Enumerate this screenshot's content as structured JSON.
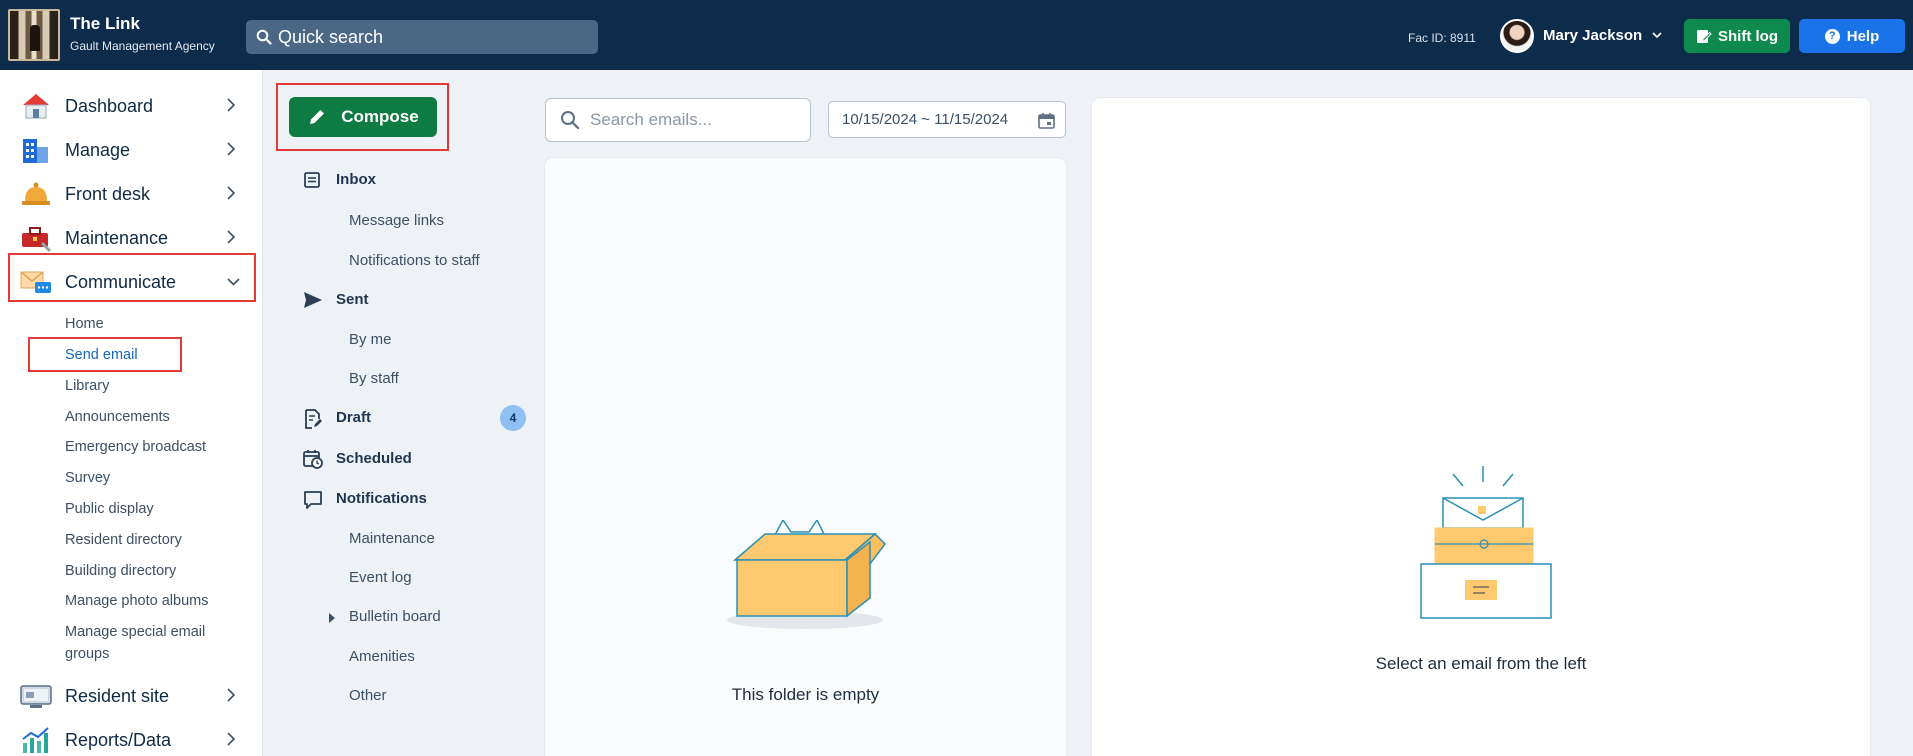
{
  "header": {
    "app_title": "The Link",
    "agency": "Gault Management Agency",
    "quick_search_placeholder": "Quick search",
    "fac_id": "Fac ID: 8911",
    "user_name": "Mary Jackson",
    "shift_log_label": "Shift log",
    "help_label": "Help"
  },
  "sidebar": {
    "items": [
      {
        "label": "Dashboard",
        "icon": "house-icon"
      },
      {
        "label": "Manage",
        "icon": "building-icon"
      },
      {
        "label": "Front desk",
        "icon": "bell-icon"
      },
      {
        "label": "Maintenance",
        "icon": "toolbox-icon"
      },
      {
        "label": "Communicate",
        "icon": "envelope-chat-icon"
      },
      {
        "label": "Resident site",
        "icon": "monitor-icon"
      },
      {
        "label": "Reports/Data",
        "icon": "chart-icon"
      }
    ],
    "communicate_sub": [
      "Home",
      "Send email",
      "Library",
      "Announcements",
      "Emergency broadcast",
      "Survey",
      "Public display",
      "Resident directory",
      "Building directory",
      "Manage photo albums",
      "Manage special email groups"
    ]
  },
  "folders": {
    "compose_label": "Compose",
    "inbox": "Inbox",
    "message_links": "Message links",
    "notifications_to_staff": "Notifications to staff",
    "sent": "Sent",
    "by_me": "By me",
    "by_staff": "By staff",
    "draft": "Draft",
    "draft_count": "4",
    "scheduled": "Scheduled",
    "notifications": "Notifications",
    "maintenance": "Maintenance",
    "event_log": "Event log",
    "bulletin_board": "Bulletin board",
    "amenities": "Amenities",
    "other": "Other"
  },
  "email_list": {
    "search_placeholder": "Search emails...",
    "date_range": "10/15/2024 ~ 11/15/2024",
    "empty_message": "This folder is empty"
  },
  "reader": {
    "empty_message": "Select an email from the left"
  },
  "colors": {
    "topbar": "#0d2b4a",
    "compose": "#0e7b43",
    "shift_log": "#0f8a4f",
    "help": "#1a73e8",
    "highlight": "#e53935",
    "active_link": "#1565c0"
  }
}
